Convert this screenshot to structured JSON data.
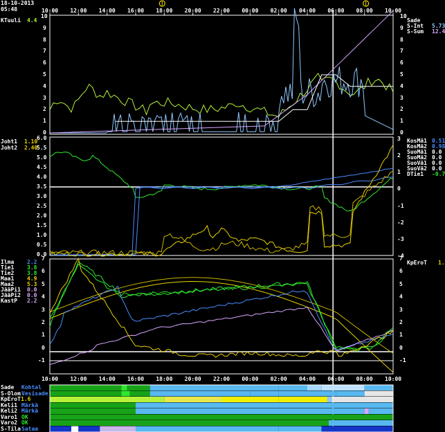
{
  "header": {
    "date": "18-10-2013",
    "time": "05:48"
  },
  "time_axis": [
    "10:00",
    "12:00",
    "14:00",
    "16:00",
    "18:00",
    "20:00",
    "22:00",
    "00:00",
    "02:00",
    "04:00",
    "06:00",
    "08:00",
    "10:00"
  ],
  "sun_icons": [
    {
      "label": "sunset",
      "time": "18:00",
      "color": "#e8d200"
    },
    {
      "label": "sunrise",
      "time": "08:00",
      "color": "#e8d200"
    }
  ],
  "panel1": {
    "left_labels": [
      {
        "name": "KTuuli",
        "value": "4.4",
        "color": "#b6f23a"
      }
    ],
    "right_labels": [
      {
        "name": "Sade",
        "value": "",
        "color": "#ffffff"
      },
      {
        "name": "S-Int",
        "value": "5.73",
        "color": "#8ec8ff"
      },
      {
        "name": "S-Sum",
        "value": "12.4",
        "color": "#d7a6ff"
      }
    ],
    "y_ticks": [
      "10",
      "9",
      "8",
      "7",
      "6",
      "5",
      "4",
      "3",
      "2",
      "1",
      "0"
    ],
    "y_range": [
      0,
      10
    ]
  },
  "panel2": {
    "left_labels": [
      {
        "name": "Joht1",
        "value": "1.10",
        "color": "#e8d200"
      },
      {
        "name": "Joht2",
        "value": "2.40",
        "color": "#e8d200"
      }
    ],
    "right_labels": [
      {
        "name": "KosMä1",
        "value": "0.51",
        "color": "#4a8cff"
      },
      {
        "name": "KosMä2",
        "value": "0.98",
        "color": "#4a8cff"
      },
      {
        "name": "SuoMä1",
        "value": "0.0",
        "color": "#ffffff"
      },
      {
        "name": "SuoMä2",
        "value": "0.0",
        "color": "#ffffff"
      },
      {
        "name": "SuoVä1",
        "value": "0.0",
        "color": "#ffffff"
      },
      {
        "name": "SuoVä2",
        "value": "0.0",
        "color": "#ffffff"
      },
      {
        "name": "DTie1",
        "value": "-0.7",
        "color": "#2ee82e"
      }
    ],
    "y_ticks_left": [
      "6.0",
      "5.5",
      "5.0",
      "4.5",
      "4.0",
      "3.5",
      "3.0",
      "2.5",
      "2.0",
      "1.5",
      "1.0",
      "0.5",
      "0.0"
    ],
    "y_ticks_right": [
      "3",
      "2",
      "1",
      "0",
      "-1",
      "-2",
      "-3",
      "-4"
    ]
  },
  "panel3": {
    "left_labels": [
      {
        "name": "Ilma",
        "value": "2.2",
        "color": "#4a8cff"
      },
      {
        "name": "Tie1",
        "value": "3.8",
        "color": "#2ee82e"
      },
      {
        "name": "Tie2",
        "value": "3.8",
        "color": "#2ee82e"
      },
      {
        "name": "Maa1",
        "value": "4.9",
        "color": "#e8d200"
      },
      {
        "name": "Maa2",
        "value": "5.3",
        "color": "#e8d200"
      },
      {
        "name": "JääPi1",
        "value": "0.0",
        "color": "#d7a6ff"
      },
      {
        "name": "JääPi2",
        "value": "0.0",
        "color": "#d7a6ff"
      },
      {
        "name": "KastP",
        "value": "2.2",
        "color": "#d7a6ff"
      }
    ],
    "right_labels": [
      {
        "name": "KpEroT",
        "value": "1.6",
        "color": "#e8d200"
      }
    ],
    "y_ticks": [
      "7",
      "6",
      "5",
      "4",
      "3",
      "2",
      "1",
      "0",
      "-1"
    ]
  },
  "status_rows": [
    {
      "name": "Sade",
      "value": "Kohtal",
      "color": "#4a8cff"
    },
    {
      "name": "S-Olom",
      "value": "Vesisade",
      "color": "#4a8cff"
    },
    {
      "name": "KpEroT",
      "value": "1.6",
      "color": "#e8d200"
    },
    {
      "name": "Keli1",
      "value": "Märkä",
      "color": "#4a8cff"
    },
    {
      "name": "Keli2",
      "value": "Märkä",
      "color": "#4a8cff"
    },
    {
      "name": "Varo1",
      "value": "OK",
      "color": "#2ee82e"
    },
    {
      "name": "Varo2",
      "value": "OK",
      "color": "#2ee82e"
    },
    {
      "name": "S-Tila",
      "value": "Sataa",
      "color": "#4a8cff"
    }
  ]
}
